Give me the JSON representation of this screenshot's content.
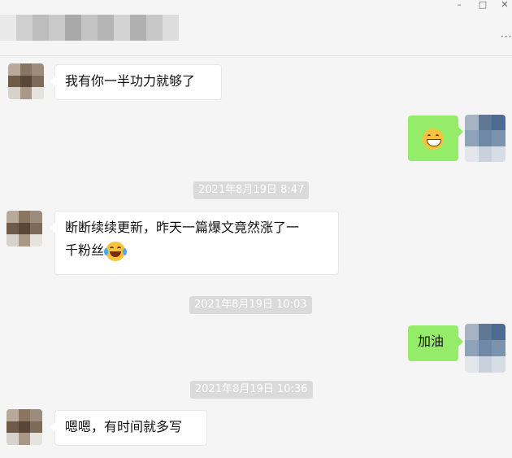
{
  "window": {
    "minimize_glyph": "–",
    "maximize_glyph": "□",
    "close_glyph": "✕",
    "more_glyph": "···"
  },
  "colors": {
    "background": "#f5f5f5",
    "incoming_bubble": "#ffffff",
    "outgoing_bubble": "#95ec69",
    "timestamp_bg": "#dadada"
  },
  "messages": [
    {
      "id": "m1",
      "dir": "in",
      "text": "我有你一半功力就够了"
    },
    {
      "id": "m2",
      "dir": "out",
      "emoji": "grinning-face"
    },
    {
      "id": "t1",
      "timestamp": "2021年8月19日 8:47"
    },
    {
      "id": "m3",
      "dir": "in",
      "line1": "断断续续更新，昨天一篇爆文竟然涨了一",
      "line2": "千粉丝",
      "emoji": "tears-of-joy"
    },
    {
      "id": "t2",
      "timestamp": "2021年8月19日 10:03"
    },
    {
      "id": "m4",
      "dir": "out",
      "text": "加油"
    },
    {
      "id": "t3",
      "timestamp": "2021年8月19日 10:36"
    },
    {
      "id": "m5",
      "dir": "in",
      "text": "嗯嗯，有时间就多写"
    }
  ]
}
